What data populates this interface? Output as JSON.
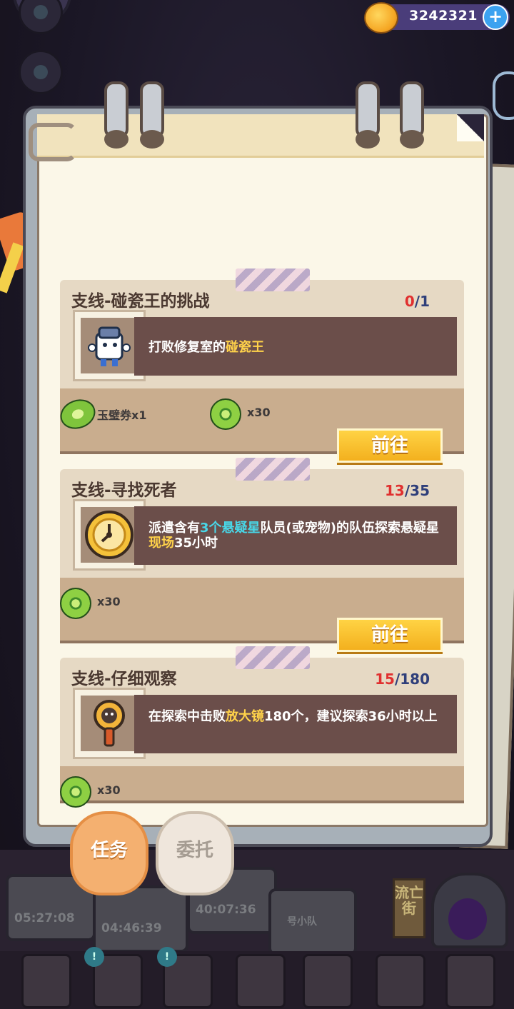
{
  "header": {
    "coins": "3242321",
    "plus_label": "+"
  },
  "quests": [
    {
      "title": "支线-碰瓷王的挑战",
      "progress_current": "0",
      "progress_sep": "/",
      "progress_total": "1",
      "desc_parts": [
        "打败修复室的",
        "碰瓷王",
        ""
      ],
      "rewards": [
        {
          "icon": "jade-voucher-icon",
          "label": "玉璧券x1"
        },
        {
          "icon": "green-coin-icon",
          "label": "x30"
        }
      ],
      "button": "前往"
    },
    {
      "title": "支线-寻找死者",
      "progress_current": "13",
      "progress_sep": "/",
      "progress_total": "35",
      "desc_parts": [
        "派遣含有",
        "3个悬疑星",
        "队员(或宠物)的队伍探索悬疑星",
        "现场",
        "35小时"
      ],
      "rewards": [
        {
          "icon": "green-coin-icon",
          "label": "x30"
        }
      ],
      "button": "前往"
    },
    {
      "title": "支线-仔细观察",
      "progress_current": "15",
      "progress_sep": "/",
      "progress_total": "180",
      "desc_parts": [
        "在探索中击败",
        "放大镜",
        "180个，建议探索36小时以上"
      ],
      "rewards": [
        {
          "icon": "green-coin-icon",
          "label": "x30"
        }
      ]
    }
  ],
  "tabs": {
    "quest": "任务",
    "commission": "委托"
  },
  "scene": {
    "timers": [
      "05:27:08",
      "04:46:39",
      "40:07:36"
    ],
    "team_label": "号小队",
    "street_sign": "流亡街"
  },
  "colors": {
    "accent_gold": "#f3b01e",
    "progress_red": "#e0302f",
    "progress_blue": "#2f3f7a",
    "highlight_yellow": "#ffd24a",
    "highlight_cyan": "#48d7e8"
  }
}
